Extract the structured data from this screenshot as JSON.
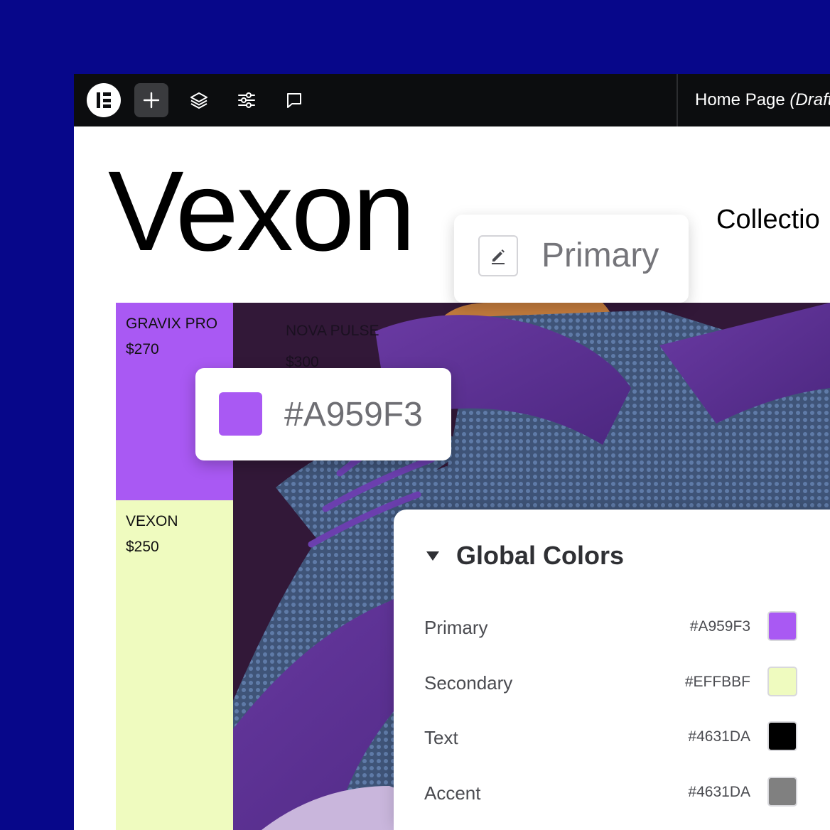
{
  "topbar": {
    "page_title": "Home Page",
    "page_status": "(Draft"
  },
  "site": {
    "brand": "Vexon",
    "nav_item": "Collectio"
  },
  "tooltip_primary": {
    "label": "Primary"
  },
  "color_chip": {
    "hex": "#A959F3",
    "color": "#A959F3"
  },
  "products": [
    {
      "name": "GRAVIX PRO",
      "price": "$270",
      "bg": "#A959F3"
    },
    {
      "name": "NOVA PULSE",
      "price": "$300"
    },
    {
      "name": "VEXON",
      "price": "$250",
      "bg": "#EFFBBF"
    }
  ],
  "global_colors": {
    "title": "Global Colors",
    "items": [
      {
        "name": "Primary",
        "code": "#A959F3",
        "swatch": "#A959F3"
      },
      {
        "name": "Secondary",
        "code": "#EFFBBF",
        "swatch": "#EFFBBF"
      },
      {
        "name": "Text",
        "code": "#4631DA",
        "swatch": "#000000"
      },
      {
        "name": "Accent",
        "code": "#4631DA",
        "swatch": "#808080"
      }
    ]
  }
}
